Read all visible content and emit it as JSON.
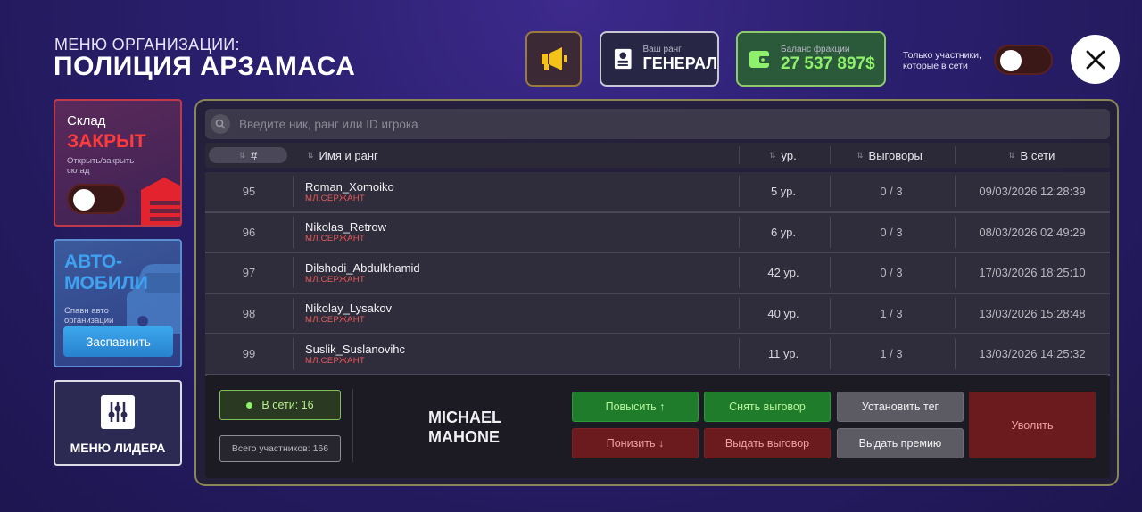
{
  "header": {
    "subtitle": "МЕНЮ ОРГАНИЗАЦИИ:",
    "title": "ПОЛИЦИЯ АРЗАМАСА",
    "rank_label": "Ваш ранг",
    "rank_value": "ГЕНЕРАЛ",
    "balance_label": "Баланс фракции",
    "balance_value": "27 537 897$",
    "online_filter_label": "Только участники, которые в сети",
    "online_filter_on": false
  },
  "sidebar": {
    "warehouse": {
      "title": "Склад",
      "status": "ЗАКРЫТ",
      "hint": "Открыть/закрыть склад",
      "toggle_on": false
    },
    "cars": {
      "title_line1": "АВТО-",
      "title_line2": "МОБИЛИ",
      "hint": "Спавн авто организации",
      "button": "Заспавнить"
    },
    "leader_menu": {
      "label": "МЕНЮ ЛИДЕРА"
    }
  },
  "search": {
    "placeholder": "Введите ник, ранг или ID игрока"
  },
  "table": {
    "columns": [
      "#",
      "Имя и ранг",
      "ур.",
      "Выговоры",
      "В сети"
    ],
    "rows": [
      {
        "num": "95",
        "name": "Roman_Xomoiko",
        "rank": "МЛ.СЕРЖАНТ",
        "level": "5 ур.",
        "warns": "0 / 3",
        "online": "09/03/2026 12:28:39"
      },
      {
        "num": "96",
        "name": "Nikolas_Retrow",
        "rank": "МЛ.СЕРЖАНТ",
        "level": "6 ур.",
        "warns": "0 / 3",
        "online": "08/03/2026 02:49:29"
      },
      {
        "num": "97",
        "name": "Dilshodi_Abdulkhamid",
        "rank": "МЛ.СЕРЖАНТ",
        "level": "42 ур.",
        "warns": "0 / 3",
        "online": "17/03/2026 18:25:10"
      },
      {
        "num": "98",
        "name": "Nikolay_Lysakov",
        "rank": "МЛ.СЕРЖАНТ",
        "level": "40 ур.",
        "warns": "1 / 3",
        "online": "13/03/2026 15:28:48"
      },
      {
        "num": "99",
        "name": "Suslik_Suslanovihc",
        "rank": "МЛ.СЕРЖАНТ",
        "level": "11 ур.",
        "warns": "1 / 3",
        "online": "13/03/2026 14:25:32"
      }
    ]
  },
  "footer": {
    "online_now": "В сети: 16",
    "total_members": "Всего участников: 166",
    "selected_player_line1": "MICHAEL",
    "selected_player_line2": "MAHONE",
    "buttons": {
      "promote": "Повысить ↑",
      "remove_warning": "Снять выговор",
      "set_tag": "Установить тег",
      "demote": "Понизить ↓",
      "give_warning": "Выдать выговор",
      "give_bonus": "Выдать премию",
      "fire": "Уволить"
    }
  },
  "colors": {
    "accent_green": "#8ef06b",
    "accent_red": "#ff3b3b",
    "accent_blue": "#3ea2f0",
    "panel_border": "#8b8655"
  }
}
